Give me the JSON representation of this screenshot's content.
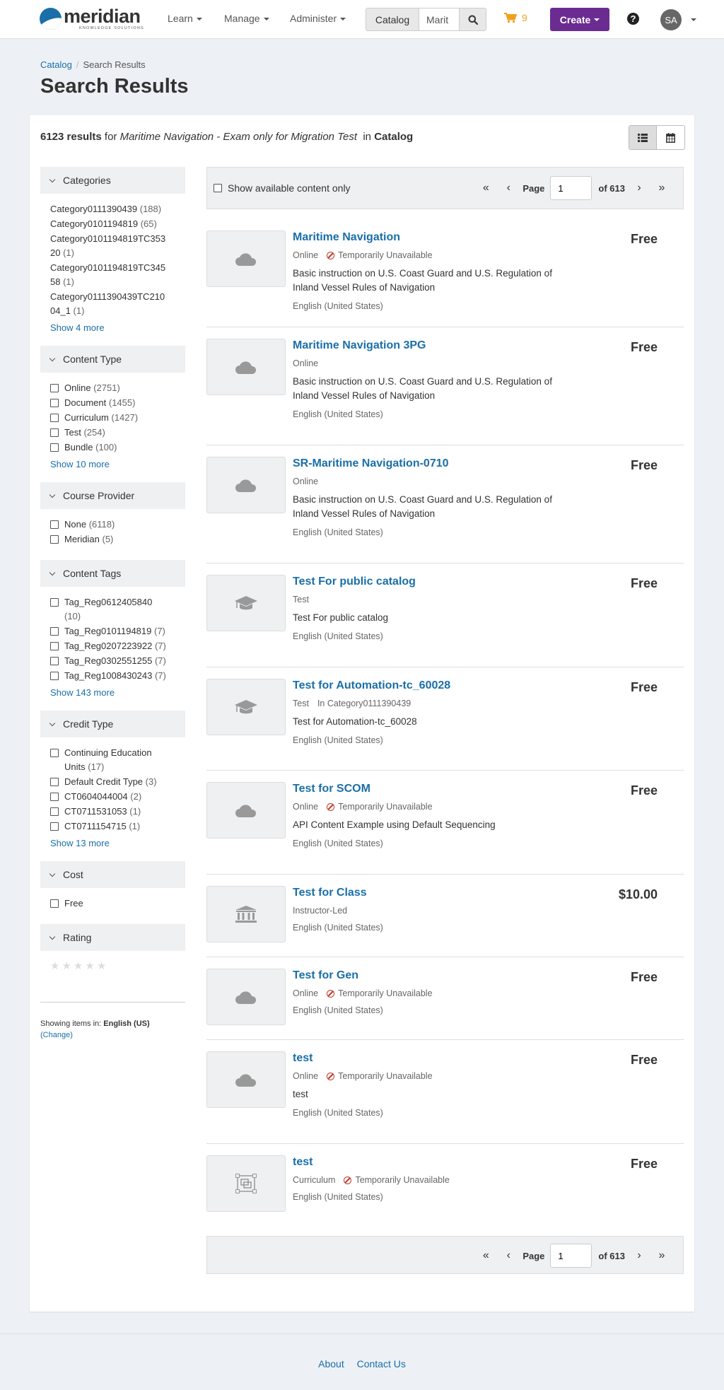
{
  "brand": {
    "name": "meridian",
    "tagline": "KNOWLEDGE SOLUTIONS"
  },
  "nav": {
    "menus": [
      "Learn",
      "Manage",
      "Administer"
    ],
    "search_scope": "Catalog",
    "search_value": "Marit",
    "cart_count": "9",
    "create_label": "Create",
    "help_label": "?",
    "avatar_initials": "SA"
  },
  "breadcrumb": {
    "parent": "Catalog",
    "current": "Search Results"
  },
  "page_title": "Search Results",
  "summary": {
    "count": "6123 results",
    "for_word": "for",
    "query": "Maritime Navigation - Exam only for Migration Test",
    "in_word": "in",
    "scope": "Catalog"
  },
  "facets": {
    "categories": {
      "title": "Categories",
      "items": [
        {
          "label": "Category0111390439",
          "count": "(188)"
        },
        {
          "label": "Category0101194819",
          "count": "(65)"
        },
        {
          "label": "Category0101194819TC353 20",
          "count": "(1)"
        },
        {
          "label": "Category0101194819TC345 58",
          "count": "(1)"
        },
        {
          "label": "Category0111390439TC210 04_1",
          "count": "(1)"
        }
      ],
      "more": "Show 4 more"
    },
    "content_type": {
      "title": "Content Type",
      "items": [
        {
          "label": "Online",
          "count": "(2751)"
        },
        {
          "label": "Document",
          "count": "(1455)"
        },
        {
          "label": "Curriculum",
          "count": "(1427)"
        },
        {
          "label": "Test",
          "count": "(254)"
        },
        {
          "label": "Bundle",
          "count": "(100)"
        }
      ],
      "more": "Show 10 more"
    },
    "course_provider": {
      "title": "Course Provider",
      "items": [
        {
          "label": "None",
          "count": "(6118)"
        },
        {
          "label": "Meridian",
          "count": "(5)"
        }
      ]
    },
    "content_tags": {
      "title": "Content Tags",
      "items": [
        {
          "label": "Tag_Reg0612405840",
          "count": "(10)"
        },
        {
          "label": "Tag_Reg0101194819",
          "count": "(7)"
        },
        {
          "label": "Tag_Reg0207223922",
          "count": "(7)"
        },
        {
          "label": "Tag_Reg0302551255",
          "count": "(7)"
        },
        {
          "label": "Tag_Reg1008430243",
          "count": "(7)"
        }
      ],
      "more": "Show 143 more"
    },
    "credit_type": {
      "title": "Credit Type",
      "items": [
        {
          "label": "Continuing Education Units",
          "count": "(17)"
        },
        {
          "label": "Default Credit Type",
          "count": "(3)"
        },
        {
          "label": "CT0604044004",
          "count": "(2)"
        },
        {
          "label": "CT0711531053",
          "count": "(1)"
        },
        {
          "label": "CT0711154715",
          "count": "(1)"
        }
      ],
      "more": "Show 13 more"
    },
    "cost": {
      "title": "Cost",
      "items": [
        {
          "label": "Free",
          "count": ""
        }
      ]
    },
    "rating": {
      "title": "Rating",
      "stars": "★★★★★"
    }
  },
  "language_note": {
    "prefix": "Showing items in:",
    "lang": "English (US)",
    "change": "(Change)"
  },
  "pager": {
    "available_label": "Show available content only",
    "page_label": "Page",
    "page_value": "1",
    "of_label": "of 613"
  },
  "results": [
    {
      "title": "Maritime Navigation",
      "type": "Online",
      "status": "Temporarily Unavailable",
      "desc": "Basic instruction on U.S. Coast Guard and U.S. Regulation of Inland Vessel Rules of Navigation",
      "lang": "English (United States)",
      "price": "Free",
      "icon": "cloud-icon"
    },
    {
      "title": "Maritime Navigation 3PG",
      "type": "Online",
      "desc": "Basic instruction on U.S. Coast Guard and U.S. Regulation of Inland Vessel Rules of Navigation",
      "lang": "English (United States)",
      "price": "Free",
      "icon": "cloud-icon"
    },
    {
      "title": "SR-Maritime Navigation-0710",
      "type": "Online",
      "desc": "Basic instruction on U.S. Coast Guard and U.S. Regulation of Inland Vessel Rules of Navigation",
      "lang": "English (United States)",
      "price": "Free",
      "icon": "cloud-icon"
    },
    {
      "title": "Test For public catalog",
      "type": "Test",
      "desc": "Test For public catalog",
      "lang": "English (United States)",
      "price": "Free",
      "icon": "graduation-cap-icon"
    },
    {
      "title": "Test for Automation-tc_60028",
      "type": "Test",
      "category": "In Category0111390439",
      "desc": "Test for Automation-tc_60028",
      "lang": "English (United States)",
      "price": "Free",
      "icon": "graduation-cap-icon"
    },
    {
      "title": "Test for SCOM",
      "type": "Online",
      "status": "Temporarily Unavailable",
      "desc": "API Content Example using Default Sequencing",
      "lang": "English (United States)",
      "price": "Free",
      "icon": "cloud-icon"
    },
    {
      "title": "Test for Class",
      "type": "Instructor-Led",
      "lang": "English (United States)",
      "price": "$10.00",
      "icon": "institution-icon"
    },
    {
      "title": "Test for Gen",
      "type": "Online",
      "status": "Temporarily Unavailable",
      "lang": "English (United States)",
      "price": "Free",
      "icon": "cloud-icon"
    },
    {
      "title": "test",
      "type": "Online",
      "status": "Temporarily Unavailable",
      "desc": "test",
      "lang": "English (United States)",
      "price": "Free",
      "icon": "cloud-icon"
    },
    {
      "title": "test",
      "type": "Curriculum",
      "status": "Temporarily Unavailable",
      "lang": "English (United States)",
      "price": "Free",
      "icon": "curriculum-icon"
    }
  ],
  "footer": {
    "about": "About",
    "contact": "Contact Us"
  },
  "colors": {
    "brand_blue": "#1a6fa8",
    "create_purple": "#6b2c91",
    "cart_orange": "#f0a020",
    "unavailable_red": "#c0392b"
  }
}
